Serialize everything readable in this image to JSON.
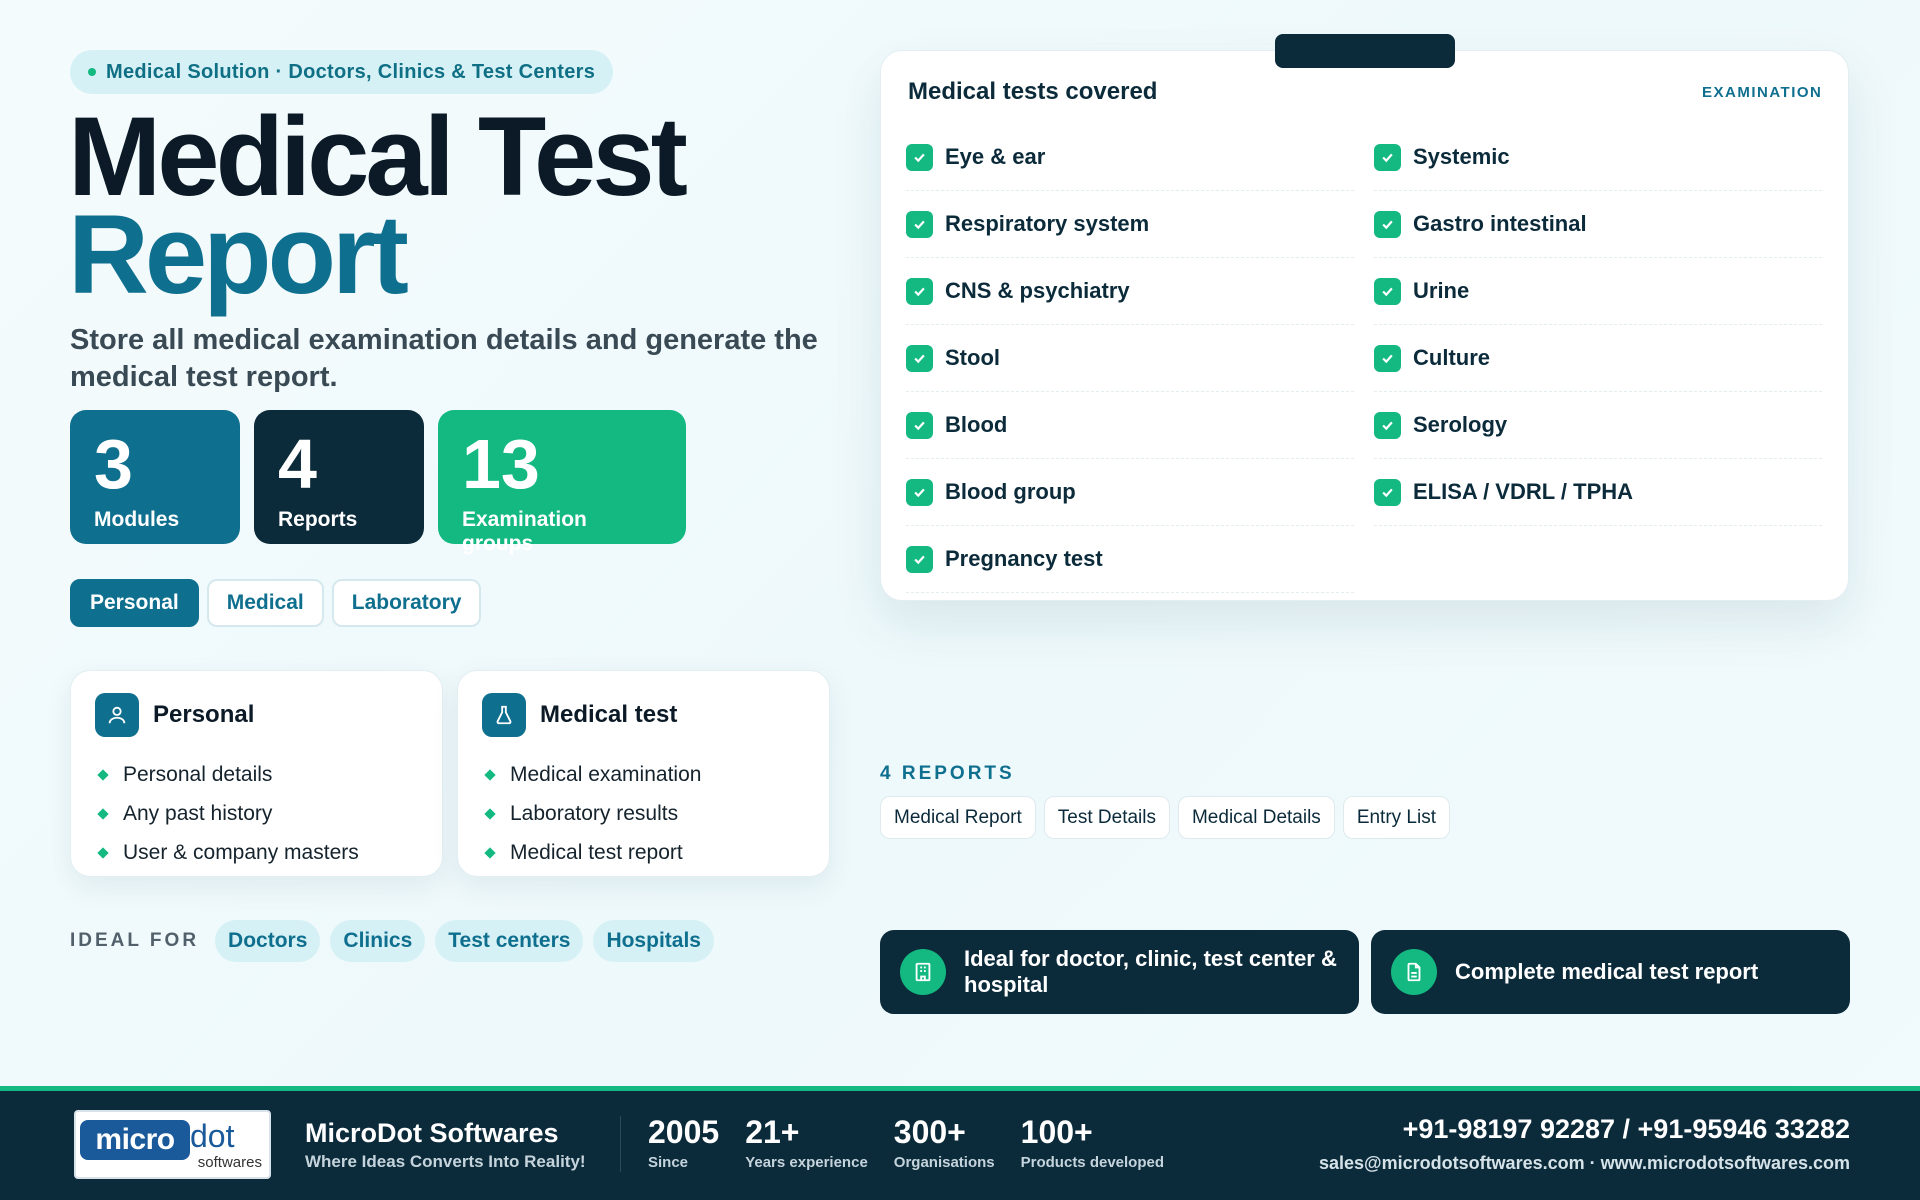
{
  "hero": {
    "eyebrow": "Medical Solution · Doctors, Clinics & Test Centers",
    "title_line1": "Medical Test",
    "title_line2": "Report",
    "subtitle": "Store all medical examination details and generate the medical test report."
  },
  "stats": [
    {
      "num": "3",
      "label": "Modules"
    },
    {
      "num": "4",
      "label": "Reports"
    },
    {
      "num": "13",
      "label": "Examination groups"
    }
  ],
  "tabs": [
    "Personal",
    "Medical",
    "Laboratory"
  ],
  "cards": [
    {
      "title": "Personal",
      "icon": "user-icon",
      "items": [
        "Personal details",
        "Any past history",
        "User & company masters"
      ]
    },
    {
      "title": "Medical test",
      "icon": "flask-icon",
      "items": [
        "Medical examination",
        "Laboratory results",
        "Medical test report"
      ]
    }
  ],
  "ideal": {
    "label": "IDEAL FOR",
    "chips": [
      "Doctors",
      "Clinics",
      "Test centers",
      "Hospitals"
    ]
  },
  "panel": {
    "title": "Medical tests covered",
    "tag": "EXAMINATION",
    "col1": [
      "Eye & ear",
      "Respiratory system",
      "CNS & psychiatry",
      "Stool",
      "Blood",
      "Blood group",
      "Pregnancy test"
    ],
    "col2": [
      "Systemic",
      "Gastro intestinal",
      "Urine",
      "Culture",
      "Serology",
      "ELISA / VDRL / TPHA"
    ]
  },
  "reports": {
    "label": "4 REPORTS",
    "chips": [
      "Medical Report",
      "Test Details",
      "Medical Details",
      "Entry List"
    ]
  },
  "cta": [
    {
      "label": "Ideal for doctor, clinic, test center & hospital",
      "icon": "building-icon"
    },
    {
      "label": "Complete medical test report",
      "icon": "document-icon"
    }
  ],
  "footer": {
    "logo_micro": "micro",
    "logo_dot": "dot",
    "logo_soft": "softwares",
    "company": "MicroDot Softwares",
    "tagline": "Where Ideas Converts Into Reality!",
    "stats": [
      {
        "n": "2005",
        "d": "Since"
      },
      {
        "n": "21+",
        "d": "Years experience"
      },
      {
        "n": "300+",
        "d": "Organisations"
      },
      {
        "n": "100+",
        "d": "Products developed"
      }
    ],
    "phones": "+91-98197 92287 / +91-95946 33282",
    "emails": "sales@microdotsoftwares.com · www.microdotsoftwares.com"
  },
  "colors": {
    "accent_teal": "#0f6f8f",
    "accent_green": "#13b981",
    "navy": "#0b2a3a"
  }
}
